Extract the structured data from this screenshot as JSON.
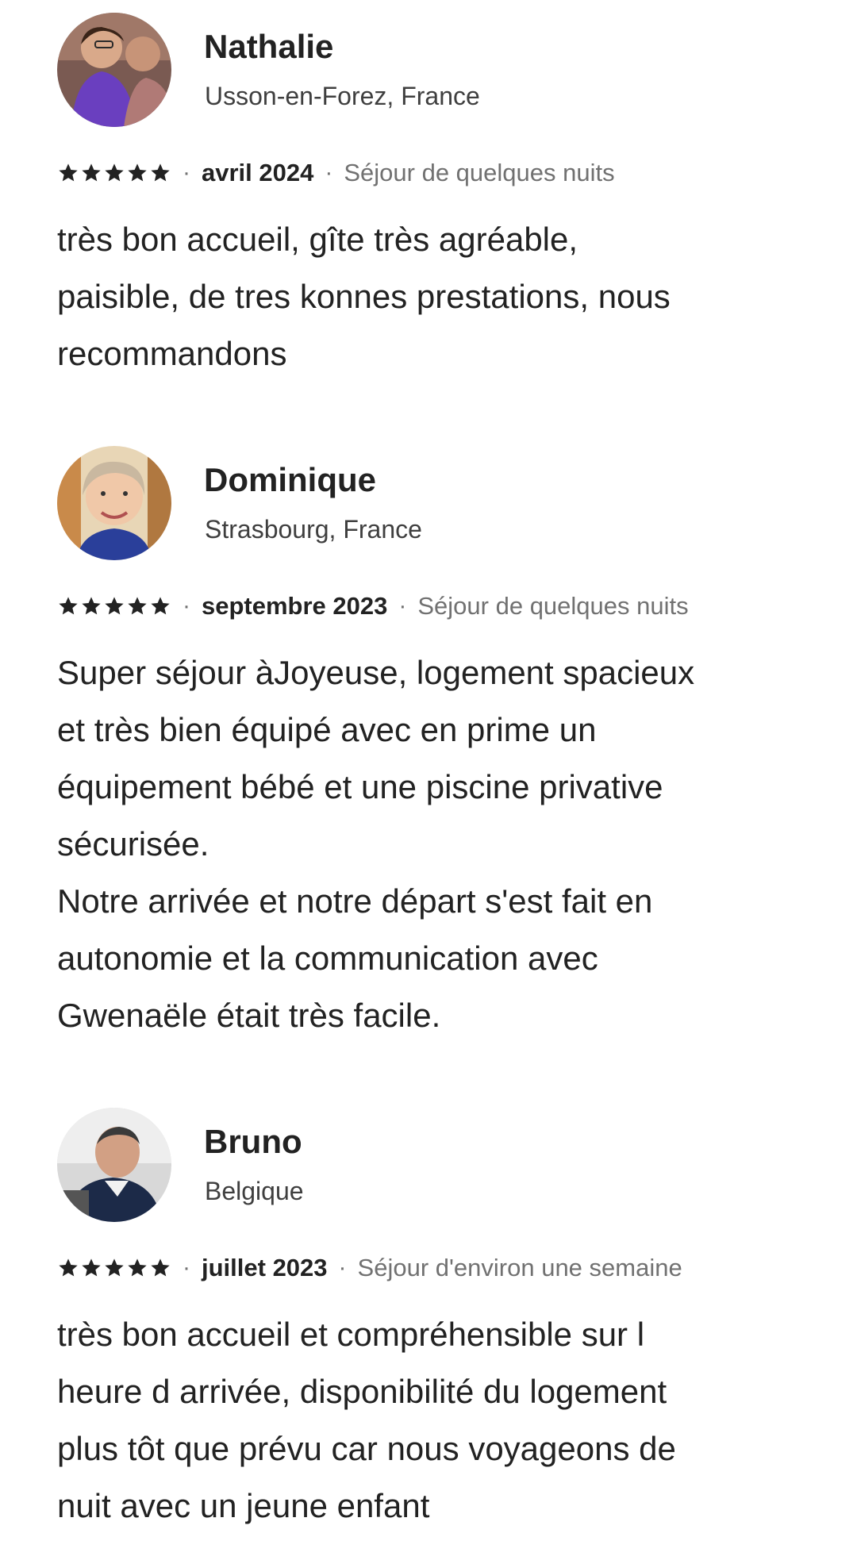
{
  "reviews": [
    {
      "name": "Nathalie",
      "location": "Usson-en-Forez, France",
      "rating": 5,
      "date": "avril 2024",
      "stay": "Séjour de quelques nuits",
      "lines": [
        "très bon accueil, gîte très agréable,",
        "paisible, de tres konnes prestations, nous",
        "recommandons"
      ]
    },
    {
      "name": "Dominique",
      "location": "Strasbourg, France",
      "rating": 5,
      "date": "septembre 2023",
      "stay": "Séjour de quelques nuits",
      "lines": [
        "Super séjour àJoyeuse, logement spacieux",
        "et très bien équipé avec en prime un",
        "équipement bébé et une piscine privative",
        "sécurisée.",
        "Notre arrivée et notre départ s'est fait en",
        "autonomie et la communication avec",
        "Gwenaële était très facile."
      ]
    },
    {
      "name": "Bruno",
      "location": "Belgique",
      "rating": 5,
      "date": "juillet 2023",
      "stay": "Séjour d'environ une semaine",
      "lines": [
        "très bon accueil et compréhensible sur l",
        "heure d arrivée, disponibilité du logement",
        "plus tôt que prévu car nous voyageons de",
        "nuit avec un jeune enfant"
      ]
    }
  ],
  "separator": "·",
  "icons": {
    "star": "star-icon"
  },
  "colors": {
    "text": "#222222",
    "secondary": "#717171",
    "star": "#222222"
  }
}
